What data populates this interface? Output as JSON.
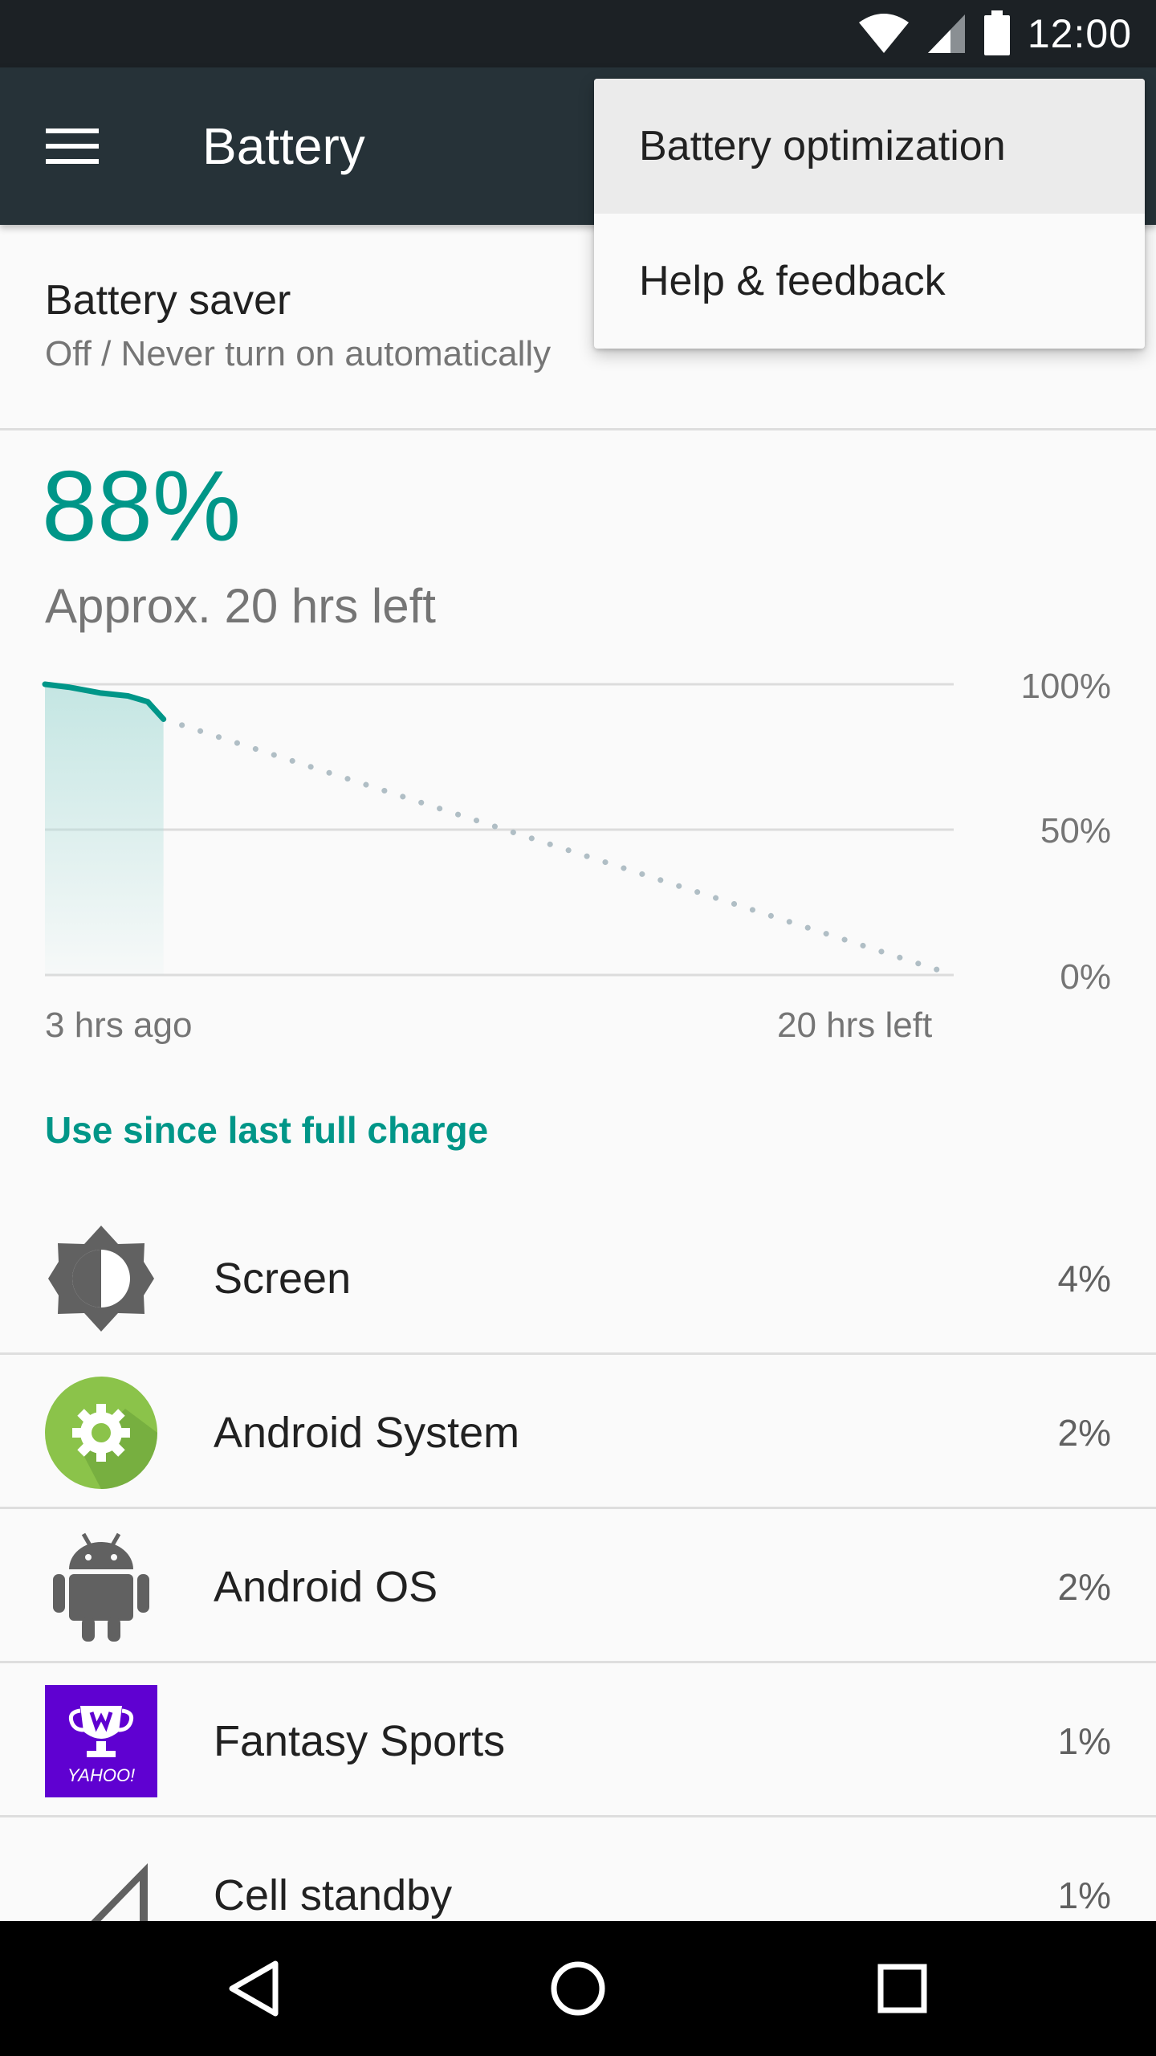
{
  "status_bar": {
    "time": "12:00",
    "icons": [
      "wifi-icon",
      "cell-signal-icon",
      "battery-icon"
    ]
  },
  "app_bar": {
    "title": "Battery",
    "menu_icon": "hamburger-menu-icon"
  },
  "overflow_menu": {
    "items": [
      {
        "label": "Battery optimization",
        "highlighted": true
      },
      {
        "label": "Help & feedback",
        "highlighted": false
      }
    ]
  },
  "battery_saver": {
    "title": "Battery saver",
    "subtitle": "Off / Never turn on automatically"
  },
  "battery": {
    "percent": "88%",
    "approx": "Approx. 20 hrs left"
  },
  "chart_data": {
    "type": "line",
    "title": "",
    "xlabel": "",
    "ylabel": "",
    "ylim": [
      0,
      100
    ],
    "y_ticks": [
      "100%",
      "50%",
      "0%"
    ],
    "x_labels": {
      "start": "3 hrs ago",
      "end": "20 hrs left"
    },
    "x_hours": [
      -3,
      20
    ],
    "series": [
      {
        "style": "solid",
        "x": [
          -3,
          -2.4,
          -1.6,
          -0.9,
          -0.4,
          0
        ],
        "y": [
          100,
          99,
          97,
          96,
          94,
          88
        ]
      },
      {
        "style": "dotted",
        "x": [
          0,
          20
        ],
        "y": [
          88,
          0
        ]
      }
    ],
    "grid": true,
    "colors": {
      "line": "#009688",
      "fill": "#b2dfdb",
      "grid": "#dcdcdc",
      "projection": "#b0bec5"
    }
  },
  "usage_section": {
    "header": "Use since last full charge",
    "items": [
      {
        "label": "Screen",
        "value": "4%",
        "icon": "brightness-icon"
      },
      {
        "label": "Android System",
        "value": "2%",
        "icon": "android-system-gear-icon"
      },
      {
        "label": "Android OS",
        "value": "2%",
        "icon": "android-robot-icon"
      },
      {
        "label": "Fantasy Sports",
        "value": "1%",
        "icon": "yahoo-fantasy-trophy-icon",
        "icon_text": "YAHOO!"
      },
      {
        "label": "Cell standby",
        "value": "1%",
        "icon": "cell-signal-icon"
      }
    ]
  },
  "nav_bar": {
    "buttons": [
      "back-icon",
      "home-icon",
      "recents-icon"
    ]
  },
  "colors": {
    "accent": "#009688",
    "app_bar": "#263238",
    "status_bar": "#1c2125"
  }
}
